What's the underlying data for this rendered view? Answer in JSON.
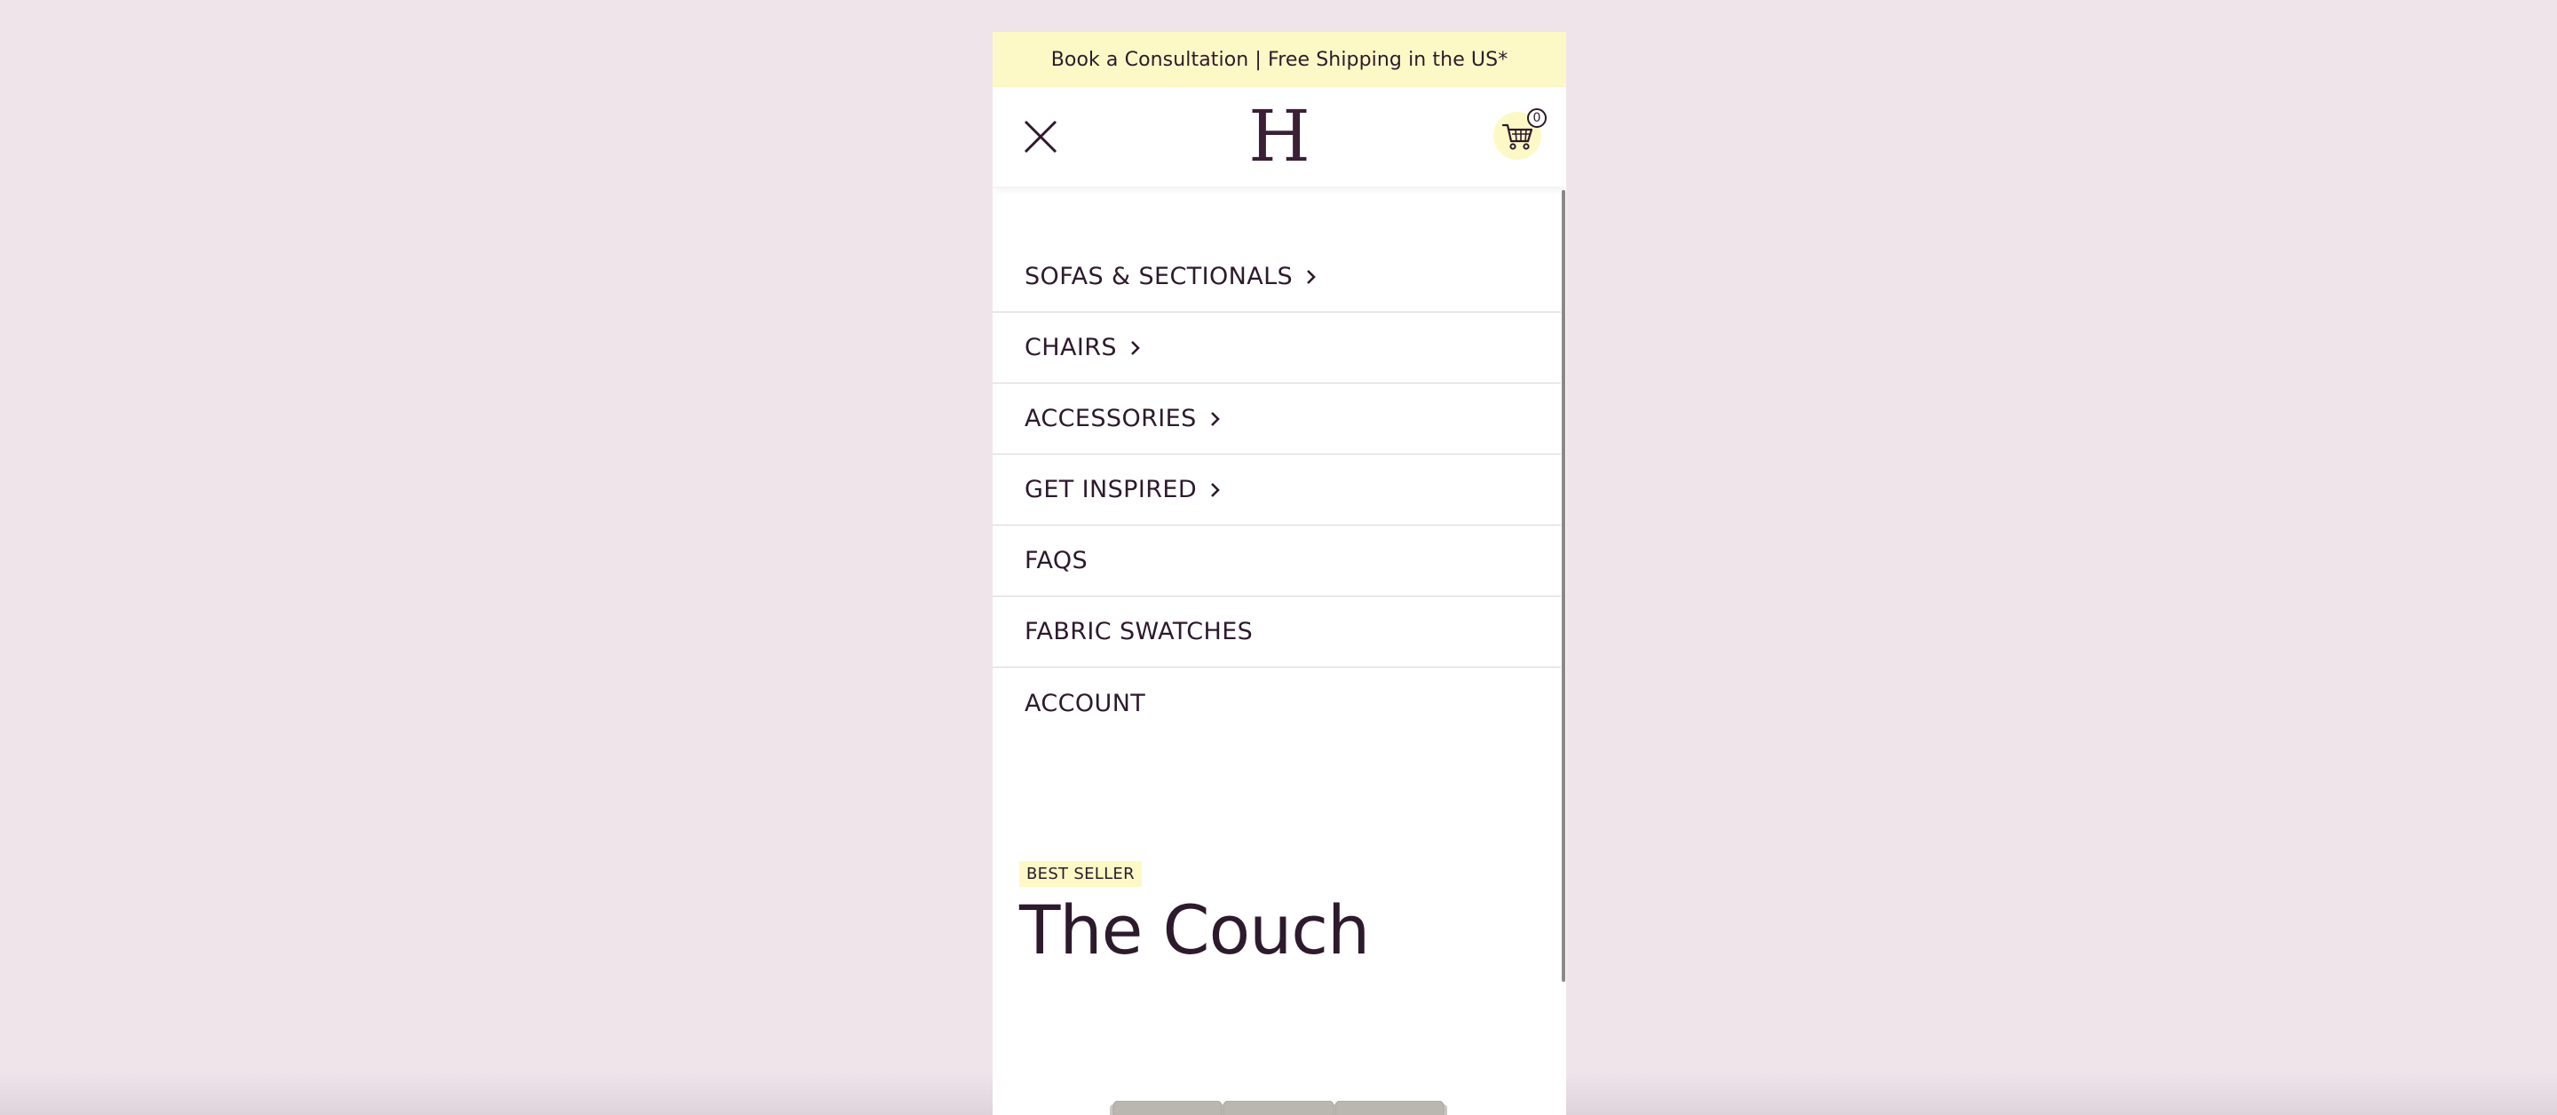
{
  "announcement": {
    "text": "Book a Consultation | Free Shipping in the US*"
  },
  "header": {
    "logo": "H",
    "close_icon": "close-icon",
    "cart_icon": "cart-icon",
    "cart_count": "0"
  },
  "menu": {
    "items": [
      {
        "label": "SOFAS & SECTIONALS",
        "has_submenu": true
      },
      {
        "label": "CHAIRS",
        "has_submenu": true
      },
      {
        "label": "ACCESSORIES",
        "has_submenu": true
      },
      {
        "label": "GET INSPIRED",
        "has_submenu": true
      },
      {
        "label": "FAQS",
        "has_submenu": false
      },
      {
        "label": "FABRIC SWATCHES",
        "has_submenu": false
      },
      {
        "label": "ACCOUNT",
        "has_submenu": false
      }
    ]
  },
  "product": {
    "badge": "BEST SELLER",
    "title": "The Couch"
  },
  "colors": {
    "background": "#f0e4eb",
    "announcement_bg": "#fdf9c6",
    "text": "#2d1a2c",
    "accent": "#3a1f35"
  }
}
